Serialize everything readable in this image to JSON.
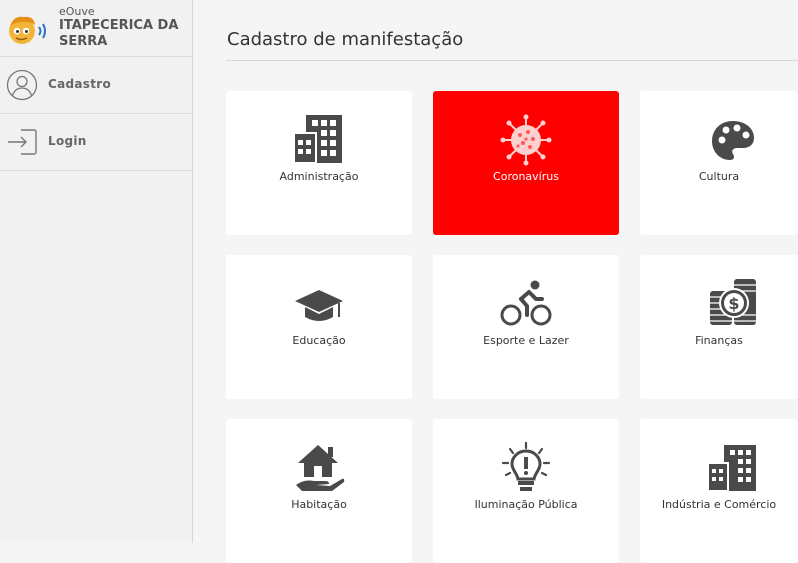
{
  "brand": {
    "app_name": "eOuve",
    "city": "ITAPECERICA DA SERRA"
  },
  "sidebar": {
    "items": [
      {
        "label": "Cadastro",
        "icon": "user-circle-icon"
      },
      {
        "label": "Login",
        "icon": "login-icon"
      }
    ]
  },
  "main": {
    "title": "Cadastro de manifestação",
    "categories": [
      {
        "label": "Administração",
        "icon": "building-icon",
        "active": false
      },
      {
        "label": "Coronavírus",
        "icon": "virus-icon",
        "active": true
      },
      {
        "label": "Cultura",
        "icon": "palette-icon",
        "active": false
      },
      {
        "label": "Educação",
        "icon": "graduation-cap-icon",
        "active": false
      },
      {
        "label": "Esporte e Lazer",
        "icon": "cyclist-icon",
        "active": false
      },
      {
        "label": "Finanças",
        "icon": "coins-icon",
        "active": false
      },
      {
        "label": "Habitação",
        "icon": "house-hand-icon",
        "active": false
      },
      {
        "label": "Iluminação Pública",
        "icon": "lightbulb-icon",
        "active": false
      },
      {
        "label": "Indústria e Comércio",
        "icon": "city-buildings-icon",
        "active": false
      }
    ]
  },
  "colors": {
    "active_card": "#ff0000",
    "icon": "#4a4a4a",
    "sidebar_bg": "#f1f1f1"
  }
}
